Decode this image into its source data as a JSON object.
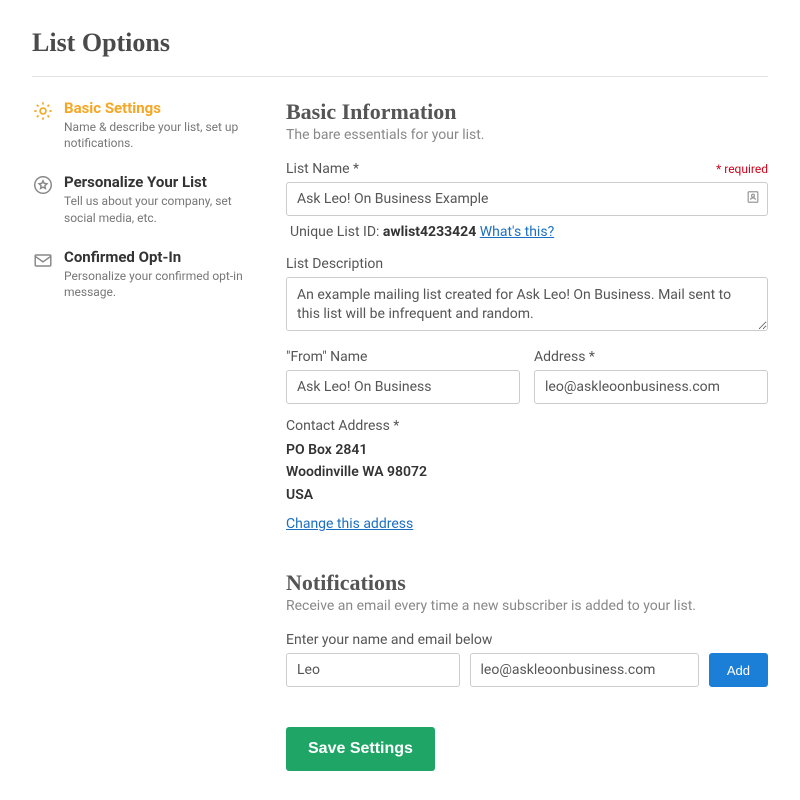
{
  "page": {
    "title": "List Options"
  },
  "sidebar": {
    "items": [
      {
        "title": "Basic Settings",
        "desc": "Name & describe your list, set up notifications."
      },
      {
        "title": "Personalize Your List",
        "desc": "Tell us about your company, set social media, etc."
      },
      {
        "title": "Confirmed Opt-In",
        "desc": "Personalize your confirmed opt-in message."
      }
    ]
  },
  "basic": {
    "heading": "Basic Information",
    "subheading": "The bare essentials for your list.",
    "list_name_label": "List Name *",
    "required_note": "* required",
    "list_name_value": "Ask Leo! On Business Example",
    "uid_label": "Unique List ID:",
    "uid_value": "awlist4233424",
    "uid_link": "What's this?",
    "desc_label": "List Description",
    "desc_value": "An example mailing list created for Ask Leo! On Business. Mail sent to this list will be infrequent and random.",
    "from_label": "\"From\" Name",
    "from_value": "Ask Leo! On Business",
    "addr_label": "Address *",
    "addr_value": "leo@askleoonbusiness.com",
    "contact_label": "Contact Address *",
    "contact_lines": [
      "PO Box 2841",
      "Woodinville WA 98072",
      "USA"
    ],
    "change_link": "Change this address"
  },
  "notifications": {
    "heading": "Notifications",
    "subheading": "Receive an email every time a new subscriber is added to your list.",
    "instruction": "Enter your name and email below",
    "name_value": "Leo",
    "email_value": "leo@askleoonbusiness.com",
    "add_label": "Add"
  },
  "actions": {
    "save_label": "Save Settings"
  }
}
